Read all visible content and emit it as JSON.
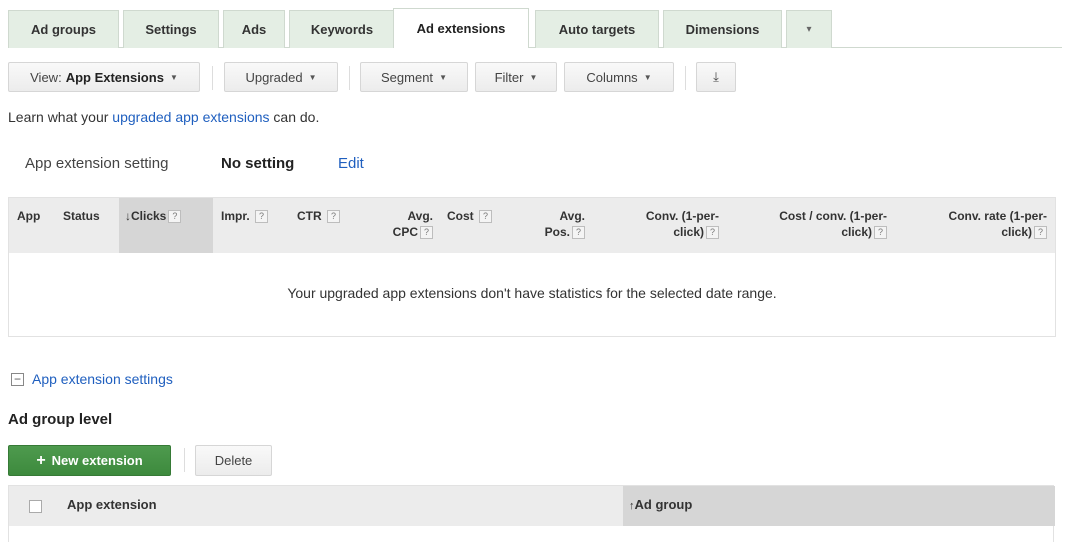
{
  "tabs": [
    {
      "label": "Ad groups"
    },
    {
      "label": "Settings"
    },
    {
      "label": "Ads"
    },
    {
      "label": "Keywords"
    },
    {
      "label": "Ad extensions"
    },
    {
      "label": "Auto targets"
    },
    {
      "label": "Dimensions"
    },
    {
      "label": "▾"
    }
  ],
  "toolbar": {
    "view_prefix": "View:",
    "view_value": "App Extensions",
    "upgraded": "Upgraded",
    "segment": "Segment",
    "filter": "Filter",
    "columns": "Columns",
    "download_icon": "⤓"
  },
  "learn": {
    "prefix": "Learn what your ",
    "link": "upgraded app extensions",
    "suffix": " can do."
  },
  "setting": {
    "label": "App extension setting",
    "value": "No setting",
    "edit": "Edit"
  },
  "stats_table": {
    "columns": {
      "app": "App",
      "status": "Status",
      "clicks": "Clicks",
      "impr": "Impr.",
      "ctr": "CTR",
      "avg_cpc_1": "Avg.",
      "avg_cpc_2": "CPC",
      "cost": "Cost",
      "avg_pos_1": "Avg.",
      "avg_pos_2": "Pos.",
      "conv_1": "Conv. (1-per-",
      "conv_2": "click)",
      "cost_conv_1": "Cost / conv. (1-per-",
      "cost_conv_2": "click)",
      "conv_rate_1": "Conv. rate (1-per-",
      "conv_rate_2": "click)"
    },
    "sort_arrow": "↓",
    "help": "?",
    "empty_message": "Your upgraded app extensions don't have statistics for the selected date range."
  },
  "settings_toggle": "App extension settings",
  "collapse_symbol": "−",
  "section_title": "Ad group level",
  "actions": {
    "new_extension": "New extension",
    "plus": "+",
    "delete": "Delete"
  },
  "extensions_table": {
    "col_extension": "App extension",
    "col_ad_group": "Ad group",
    "sort_arrow": "↑"
  }
}
